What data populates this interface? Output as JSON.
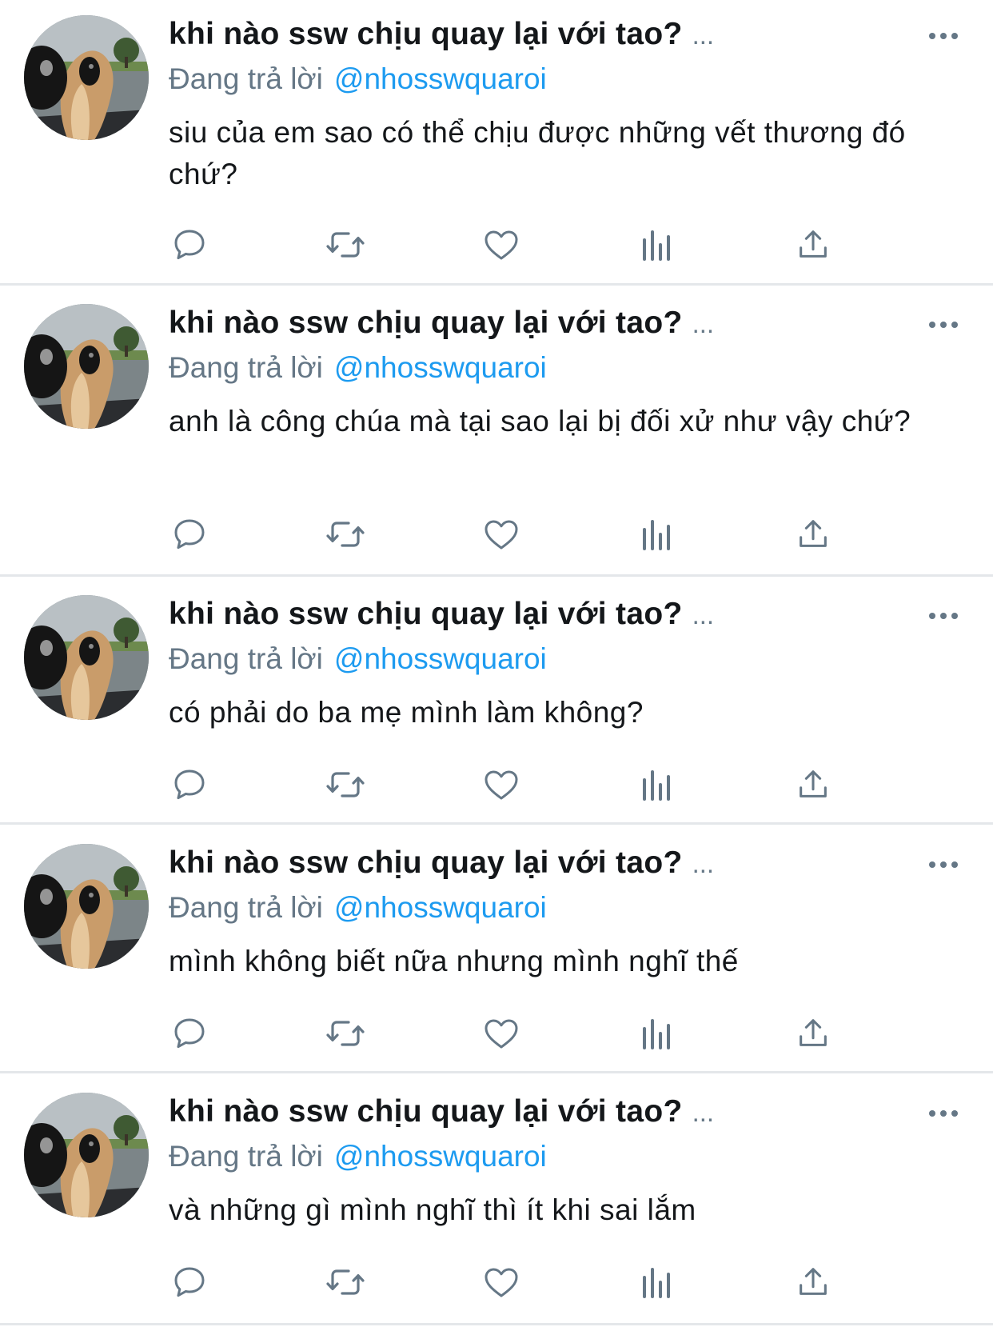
{
  "colors": {
    "name": "#14171a",
    "secondary": "#657786",
    "handle": "#1d9bf0",
    "divider": "#e4e7ea",
    "icon": "#657786"
  },
  "icons": {
    "avatar": "plush-avatar",
    "more": "more-dots-icon",
    "actions": [
      "reply-icon",
      "retweet-icon",
      "like-icon",
      "analytics-icon",
      "share-icon"
    ]
  },
  "tweets": [
    {
      "display_name": "khi nào ssw chịu quay lại với tao?",
      "name_ellipsis": "...",
      "reply_prefix": "Đang trả lời",
      "reply_handle": "@nhosswquaroi",
      "text": "siu của em sao có thể chịu được những vết thương đó chứ?"
    },
    {
      "display_name": "khi nào ssw chịu quay lại với tao?",
      "name_ellipsis": "...",
      "reply_prefix": "Đang trả lời",
      "reply_handle": "@nhosswquaroi",
      "text": "anh là công chúa mà tại sao lại bị đối xử như vậy chứ?"
    },
    {
      "display_name": "khi nào ssw chịu quay lại với tao?",
      "name_ellipsis": "...",
      "reply_prefix": "Đang trả lời",
      "reply_handle": "@nhosswquaroi",
      "text": "có phải do ba mẹ mình làm không?"
    },
    {
      "display_name": "khi nào ssw chịu quay lại với tao?",
      "name_ellipsis": "...",
      "reply_prefix": "Đang trả lời",
      "reply_handle": "@nhosswquaroi",
      "text": "mình không biết nữa nhưng mình nghĩ thế"
    },
    {
      "display_name": "khi nào ssw chịu quay lại với tao?",
      "name_ellipsis": "...",
      "reply_prefix": "Đang trả lời",
      "reply_handle": "@nhosswquaroi",
      "text": "và những gì mình nghĩ thì ít khi sai lắm"
    }
  ]
}
